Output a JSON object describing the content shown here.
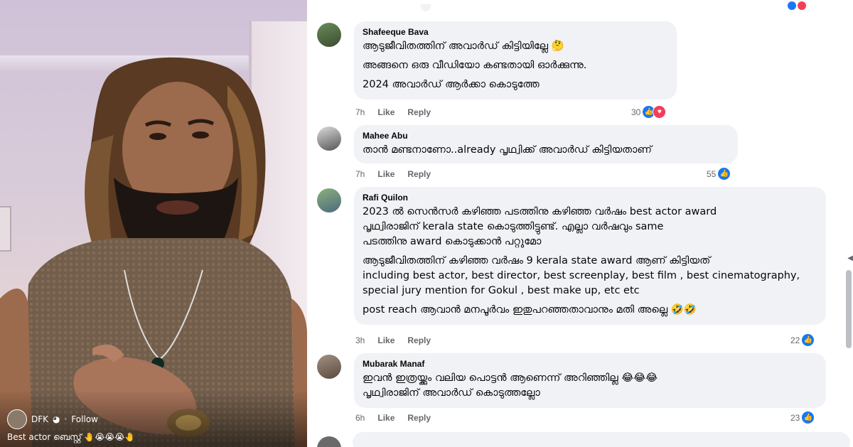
{
  "video": {
    "creator_name": "DFK",
    "follow_label": "Follow",
    "caption": "Best actor ബെസ്റ്റ് 🤚😭😭😭🤚"
  },
  "comments": [
    {
      "author": "Shafeeque Bava",
      "lines": [
        "ആടുജീവിതത്തിന് അവാർഡ് കിട്ടിയില്ലേ 🤔",
        "അങ്ങനെ ഒരു വീഡിയോ കണ്ടതായി ഓർക്കുന്നു.",
        "2024 അവാർഡ് ആർക്കാ കൊടുത്തേ"
      ],
      "time": "7h",
      "like": "Like",
      "reply": "Reply",
      "count": "30"
    },
    {
      "author": "Mahee Abu",
      "lines": [
        "താൻ മണ്ടനാണോ..already പൃഥ്വിക്ക് അവാർഡ് കിട്ടിയതാണ്"
      ],
      "time": "7h",
      "like": "Like",
      "reply": "Reply",
      "count": "55"
    },
    {
      "author": "Rafi Quilon",
      "lines": [
        "2023 ൽ സെൻസർ കഴിഞ്ഞ പടത്തിനു കഴിഞ്ഞ വർഷം best actor award",
        "പൃഥ്വിരാജിന് kerala state കൊടുത്തിട്ടുണ്ട്. എല്ലാ വർഷവും same",
        "പടത്തിനു award കൊടുക്കാൻ പറ്റുമോ",
        "ആടുജീവിതത്തിന് കഴിഞ്ഞ വർഷം 9 kerala state award ആണ് കിട്ടിയത്",
        "including best actor, best director, best screenplay, best film , best cinematography,",
        "special jury mention for Gokul , best make up, etc etc",
        "post reach ആവാൻ മനപൂർവം ഇതുപറഞ്ഞതാവാനും മതി അല്ലെ 🤣🤣"
      ],
      "time": "3h",
      "like": "Like",
      "reply": "Reply",
      "count": "22"
    },
    {
      "author": "Mubarak Manaf",
      "lines": [
        "ഇവൻ ഇത്രയ്ക്കും വലിയ പൊട്ടൻ ആണെന്ന് അറിഞ്ഞില്ല 😂😂😂",
        "പൃഥ്വിരാജിന് അവാർഡ് കൊടുത്തല്ലോ"
      ],
      "time": "6h",
      "like": "Like",
      "reply": "Reply",
      "count": "23"
    }
  ],
  "colors": {
    "like_blue": "#1877f2",
    "heart_red": "#f33e58",
    "bubble": "#f0f2f5",
    "meta": "#65676b"
  }
}
